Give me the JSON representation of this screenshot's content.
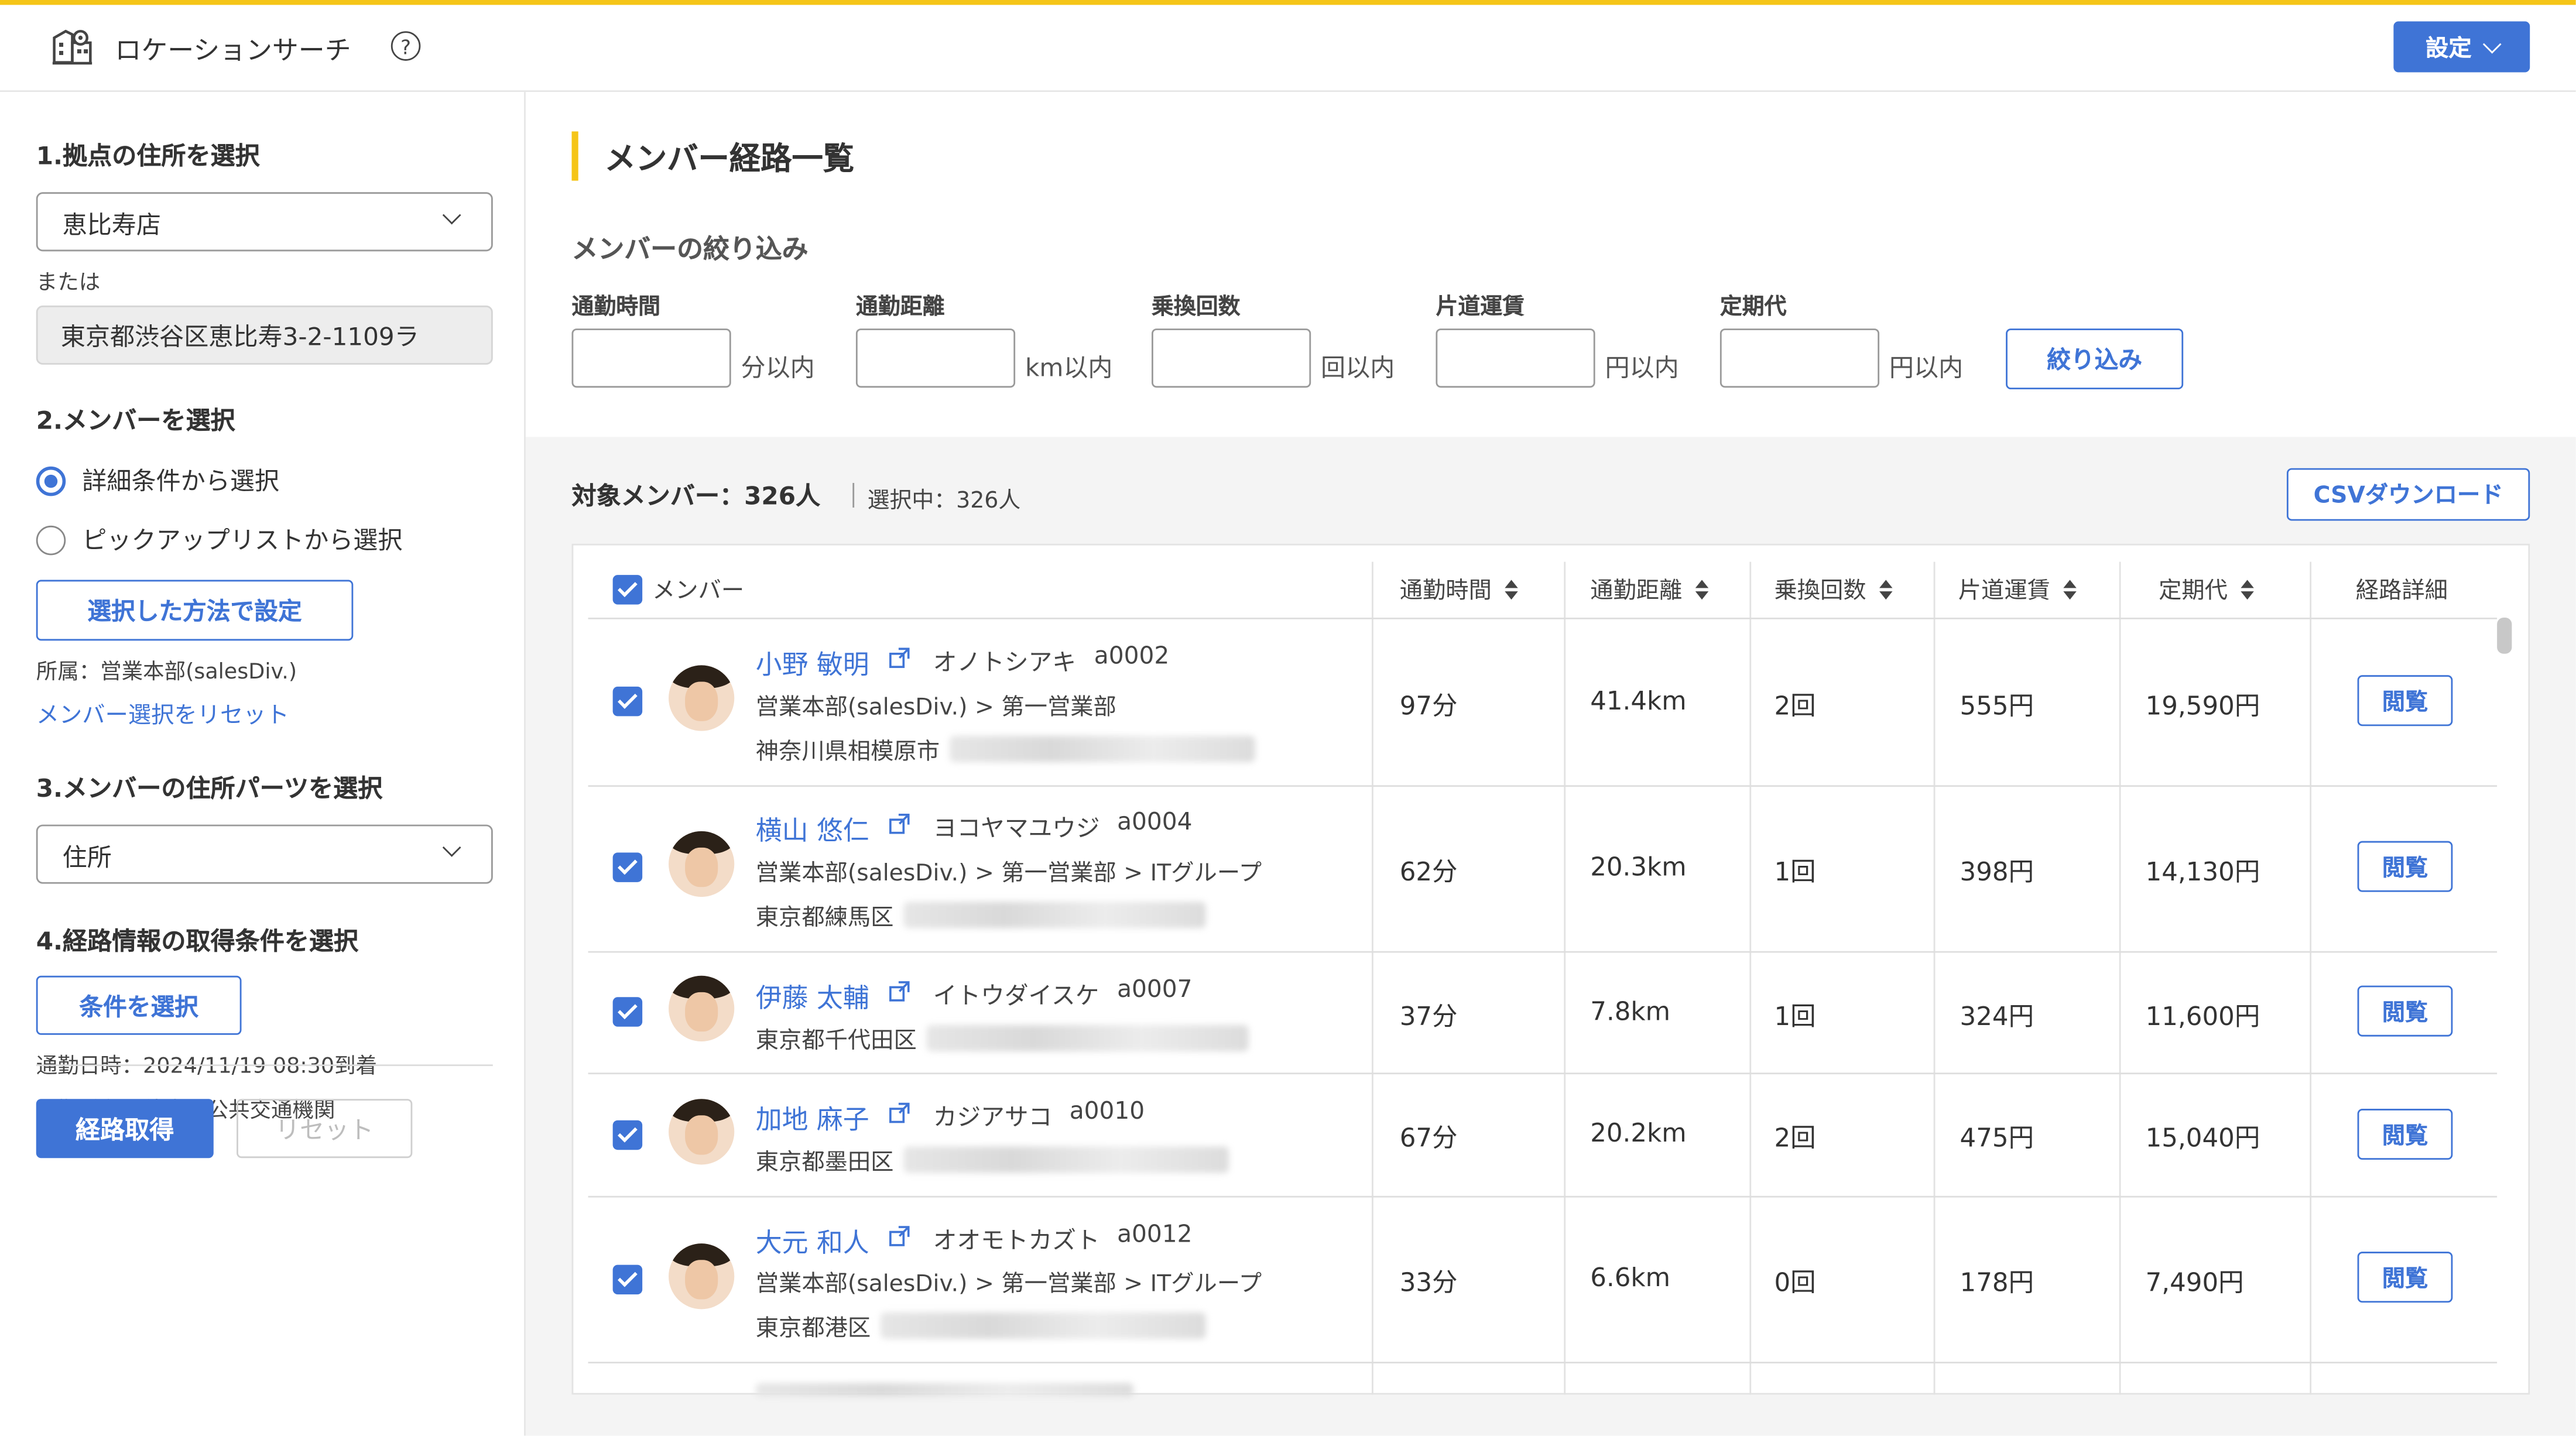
{
  "header": {
    "app_title": "ロケーションサーチ",
    "help_glyph": "?",
    "settings_label": "設定"
  },
  "sidebar": {
    "step1_title": "1.拠点の住所を選択",
    "store_select_value": "恵比寿店",
    "or_label": "または",
    "address_value": "東京都渋谷区恵比寿3-2-1109ラ",
    "step2_title": "2.メンバーを選択",
    "radio_detail_label": "詳細条件から選択",
    "radio_picklist_label": "ピックアップリストから選択",
    "apply_method_label": "選択した方法で設定",
    "affiliation_text": "所属：営業本部(salesDiv.)",
    "reset_members_link": "メンバー選択をリセット",
    "step3_title": "3.メンバーの住所パーツを選択",
    "address_part_value": "住所",
    "step4_title": "4.経路情報の取得条件を選択",
    "condition_button_label": "条件を選択",
    "commute_datetime": "通勤日時：2024/11/19 08:30到着",
    "commute_method": "通勤手段：徒歩＋公共交通機関",
    "get_route_label": "経路取得",
    "reset_label": "リセット"
  },
  "main": {
    "title": "メンバー経路一覧",
    "filter_title": "メンバーの絞り込み",
    "filters": [
      {
        "label": "通勤時間",
        "unit": "分以内"
      },
      {
        "label": "通勤距離",
        "unit": "km以内"
      },
      {
        "label": "乗換回数",
        "unit": "回以内"
      },
      {
        "label": "片道運賃",
        "unit": "円以内"
      },
      {
        "label": "定期代",
        "unit": "円以内"
      }
    ],
    "filter_button_label": "絞り込み",
    "target_members": "対象メンバー：326人",
    "selected_members": "選択中：326人",
    "csv_label": "CSVダウンロード",
    "columns": {
      "member": "メンバー",
      "time": "通勤時間",
      "distance": "通勤距離",
      "transfers": "乗換回数",
      "fare": "片道運賃",
      "pass": "定期代",
      "detail": "経路詳細"
    },
    "view_label": "閲覧",
    "rows": [
      {
        "name": "小野 敏明",
        "kana": "オノトシアキ",
        "id": "a0002",
        "org": "営業本部(salesDiv.) > 第一営業部",
        "address": "神奈川県相模原市",
        "time": "97分",
        "distance": "41.4km",
        "transfers": "2回",
        "fare": "555円",
        "pass": "19,590円"
      },
      {
        "name": "横山 悠仁",
        "kana": "ヨコヤマユウジ",
        "id": "a0004",
        "org": "営業本部(salesDiv.) > 第一営業部 > ITグループ",
        "address": "東京都練馬区",
        "time": "62分",
        "distance": "20.3km",
        "transfers": "1回",
        "fare": "398円",
        "pass": "14,130円"
      },
      {
        "name": "伊藤 太輔",
        "kana": "イトウダイスケ",
        "id": "a0007",
        "org": "",
        "address": "東京都千代田区",
        "time": "37分",
        "distance": "7.8km",
        "transfers": "1回",
        "fare": "324円",
        "pass": "11,600円"
      },
      {
        "name": "加地 麻子",
        "kana": "カジアサコ",
        "id": "a0010",
        "org": "",
        "address": "東京都墨田区",
        "time": "67分",
        "distance": "20.2km",
        "transfers": "2回",
        "fare": "475円",
        "pass": "15,040円"
      },
      {
        "name": "大元 和人",
        "kana": "オオモトカズト",
        "id": "a0012",
        "org": "営業本部(salesDiv.) > 第一営業部 > ITグループ",
        "address": "東京都港区",
        "time": "33分",
        "distance": "6.6km",
        "transfers": "0回",
        "fare": "178円",
        "pass": "7,490円"
      }
    ]
  },
  "colors": {
    "accent": "#3f74d6",
    "highlight": "#f5c518",
    "panel_gray": "#f4f4f4"
  },
  "icons": {
    "app": "building-pin-icon",
    "help": "help-circle-icon",
    "external": "external-link-icon",
    "sort": "sort-icon",
    "checkbox": "checkbox-checked-icon"
  }
}
